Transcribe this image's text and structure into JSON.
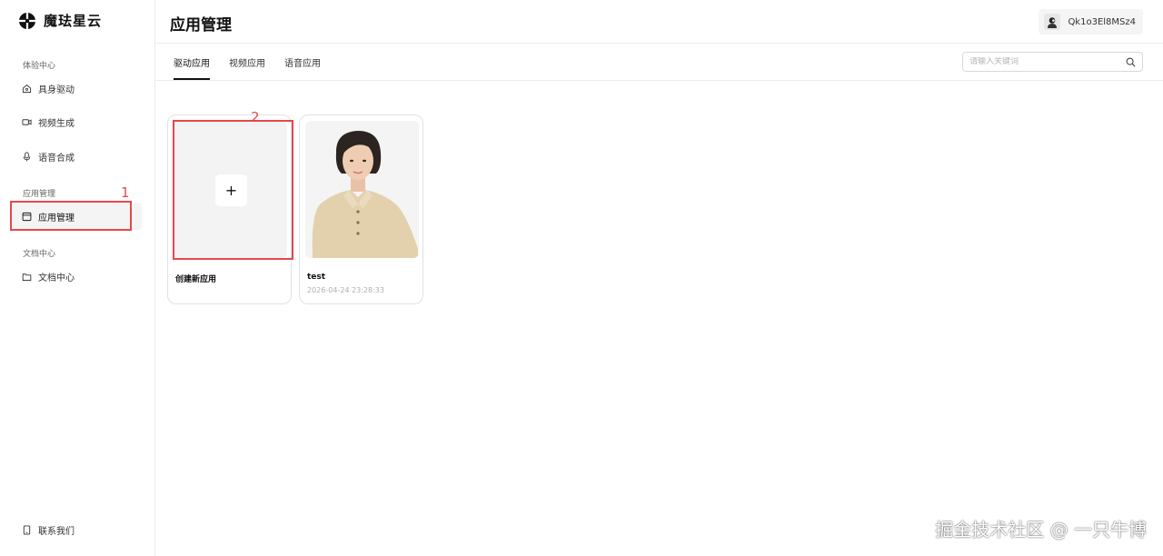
{
  "app": {
    "name": "魔珐星云"
  },
  "sidebar": {
    "sections": [
      {
        "label": "体验中心"
      },
      {
        "label": "应用管理"
      },
      {
        "label": "文档中心"
      }
    ],
    "items": [
      {
        "label": "具身驱动",
        "icon": "home-icon"
      },
      {
        "label": "视频生成",
        "icon": "video-icon"
      },
      {
        "label": "语音合成",
        "icon": "microphone-icon"
      },
      {
        "label": "应用管理",
        "icon": "app-box-icon",
        "active": true
      },
      {
        "label": "文档中心",
        "icon": "document-icon"
      }
    ],
    "footer": {
      "label": "联系我们",
      "icon": "phone-icon"
    }
  },
  "header": {
    "title": "应用管理",
    "user": "Qk1o3El8MSz4"
  },
  "tabs": [
    {
      "label": "驱动应用",
      "active": true
    },
    {
      "label": "视频应用"
    },
    {
      "label": "语音应用"
    }
  ],
  "search": {
    "placeholder": "请输入关键词"
  },
  "cards": [
    {
      "title": "创建新应用",
      "icon": "plus-icon"
    },
    {
      "title": "test",
      "date": "2026-04-24 23:28:33"
    }
  ],
  "annotations": [
    "1",
    "2"
  ],
  "watermark": "掘金技术社区 @ 一只牛博",
  "colors": {
    "annotation": "#e5484d",
    "accent": "#111111"
  }
}
